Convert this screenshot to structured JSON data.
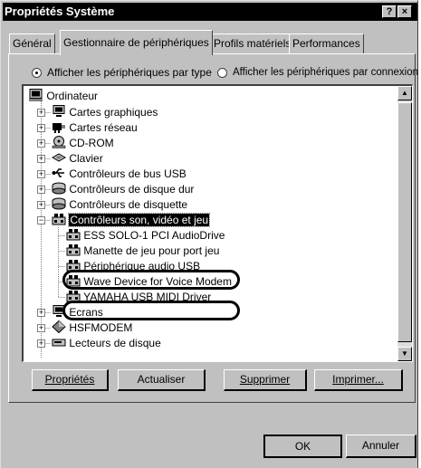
{
  "window": {
    "title": "Propriétés Système",
    "help_label": "?",
    "close_label": "×"
  },
  "tabs": [
    {
      "label": "Général",
      "active": false
    },
    {
      "label": "Gestionnaire de périphériques",
      "active": true
    },
    {
      "label": "Profils matériels",
      "active": false
    },
    {
      "label": "Performances",
      "active": false
    }
  ],
  "view_options": {
    "by_type_label": "Afficher les périphériques par type",
    "by_connection_label": "Afficher les périphériques par connexion",
    "selected": "by_type"
  },
  "tree": {
    "root": "Ordinateur",
    "categories": [
      {
        "label": "Cartes graphiques",
        "icon": "monitor-icon",
        "expanded": false
      },
      {
        "label": "Cartes réseau",
        "icon": "network-card-icon",
        "expanded": false
      },
      {
        "label": "CD-ROM",
        "icon": "cdrom-icon",
        "expanded": false
      },
      {
        "label": "Clavier",
        "icon": "keyboard-icon",
        "expanded": false
      },
      {
        "label": "Contrôleurs de bus USB",
        "icon": "usb-icon",
        "expanded": false
      },
      {
        "label": "Contrôleurs de disque dur",
        "icon": "hard-disk-icon",
        "expanded": false
      },
      {
        "label": "Contrôleurs de disquette",
        "icon": "floppy-icon",
        "expanded": false
      },
      {
        "label": "Contrôleurs son, vidéo et jeu",
        "icon": "sound-device-icon",
        "expanded": true,
        "selected": true,
        "children": [
          {
            "label": "ESS SOLO-1 PCI AudioDrive",
            "highlighted": false
          },
          {
            "label": "Manette de jeu pour port jeu",
            "highlighted": false
          },
          {
            "label": "Périphérique audio USB",
            "highlighted": true
          },
          {
            "label": "Wave Device for Voice Modem",
            "highlighted": false
          },
          {
            "label": "YAMAHA USB MIDI Driver",
            "highlighted": true
          }
        ]
      },
      {
        "label": "Ecrans",
        "icon": "monitor-icon",
        "expanded": false
      },
      {
        "label": "HSFMODEM",
        "icon": "diamond-icon",
        "expanded": false
      },
      {
        "label": "Lecteurs de disque",
        "icon": "disk-drive-icon",
        "expanded": false
      }
    ]
  },
  "action_buttons": {
    "properties": "Propriétés",
    "refresh": "Actualiser",
    "remove": "Supprimer",
    "print": "Imprimer..."
  },
  "dialog_buttons": {
    "ok": "OK",
    "cancel": "Annuler"
  },
  "colors": {
    "face": "#c0c0c0",
    "titlebar": "#000000",
    "selection": "#000000"
  }
}
